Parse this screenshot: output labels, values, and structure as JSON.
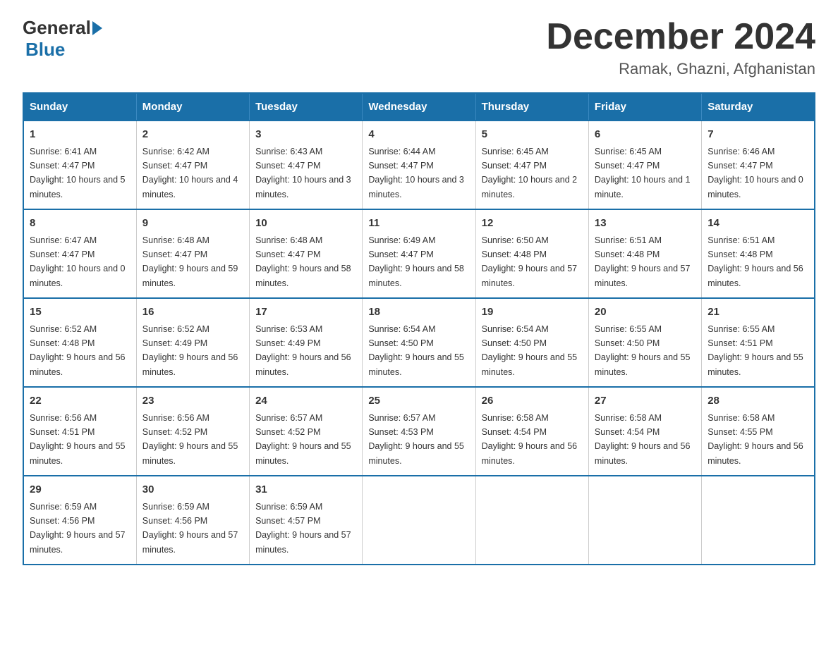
{
  "header": {
    "logo_general": "General",
    "logo_blue": "Blue",
    "month_title": "December 2024",
    "location": "Ramak, Ghazni, Afghanistan"
  },
  "weekdays": [
    "Sunday",
    "Monday",
    "Tuesday",
    "Wednesday",
    "Thursday",
    "Friday",
    "Saturday"
  ],
  "weeks": [
    [
      {
        "day": "1",
        "sunrise": "6:41 AM",
        "sunset": "4:47 PM",
        "daylight": "10 hours and 5 minutes."
      },
      {
        "day": "2",
        "sunrise": "6:42 AM",
        "sunset": "4:47 PM",
        "daylight": "10 hours and 4 minutes."
      },
      {
        "day": "3",
        "sunrise": "6:43 AM",
        "sunset": "4:47 PM",
        "daylight": "10 hours and 3 minutes."
      },
      {
        "day": "4",
        "sunrise": "6:44 AM",
        "sunset": "4:47 PM",
        "daylight": "10 hours and 3 minutes."
      },
      {
        "day": "5",
        "sunrise": "6:45 AM",
        "sunset": "4:47 PM",
        "daylight": "10 hours and 2 minutes."
      },
      {
        "day": "6",
        "sunrise": "6:45 AM",
        "sunset": "4:47 PM",
        "daylight": "10 hours and 1 minute."
      },
      {
        "day": "7",
        "sunrise": "6:46 AM",
        "sunset": "4:47 PM",
        "daylight": "10 hours and 0 minutes."
      }
    ],
    [
      {
        "day": "8",
        "sunrise": "6:47 AM",
        "sunset": "4:47 PM",
        "daylight": "10 hours and 0 minutes."
      },
      {
        "day": "9",
        "sunrise": "6:48 AM",
        "sunset": "4:47 PM",
        "daylight": "9 hours and 59 minutes."
      },
      {
        "day": "10",
        "sunrise": "6:48 AM",
        "sunset": "4:47 PM",
        "daylight": "9 hours and 58 minutes."
      },
      {
        "day": "11",
        "sunrise": "6:49 AM",
        "sunset": "4:47 PM",
        "daylight": "9 hours and 58 minutes."
      },
      {
        "day": "12",
        "sunrise": "6:50 AM",
        "sunset": "4:48 PM",
        "daylight": "9 hours and 57 minutes."
      },
      {
        "day": "13",
        "sunrise": "6:51 AM",
        "sunset": "4:48 PM",
        "daylight": "9 hours and 57 minutes."
      },
      {
        "day": "14",
        "sunrise": "6:51 AM",
        "sunset": "4:48 PM",
        "daylight": "9 hours and 56 minutes."
      }
    ],
    [
      {
        "day": "15",
        "sunrise": "6:52 AM",
        "sunset": "4:48 PM",
        "daylight": "9 hours and 56 minutes."
      },
      {
        "day": "16",
        "sunrise": "6:52 AM",
        "sunset": "4:49 PM",
        "daylight": "9 hours and 56 minutes."
      },
      {
        "day": "17",
        "sunrise": "6:53 AM",
        "sunset": "4:49 PM",
        "daylight": "9 hours and 56 minutes."
      },
      {
        "day": "18",
        "sunrise": "6:54 AM",
        "sunset": "4:50 PM",
        "daylight": "9 hours and 55 minutes."
      },
      {
        "day": "19",
        "sunrise": "6:54 AM",
        "sunset": "4:50 PM",
        "daylight": "9 hours and 55 minutes."
      },
      {
        "day": "20",
        "sunrise": "6:55 AM",
        "sunset": "4:50 PM",
        "daylight": "9 hours and 55 minutes."
      },
      {
        "day": "21",
        "sunrise": "6:55 AM",
        "sunset": "4:51 PM",
        "daylight": "9 hours and 55 minutes."
      }
    ],
    [
      {
        "day": "22",
        "sunrise": "6:56 AM",
        "sunset": "4:51 PM",
        "daylight": "9 hours and 55 minutes."
      },
      {
        "day": "23",
        "sunrise": "6:56 AM",
        "sunset": "4:52 PM",
        "daylight": "9 hours and 55 minutes."
      },
      {
        "day": "24",
        "sunrise": "6:57 AM",
        "sunset": "4:52 PM",
        "daylight": "9 hours and 55 minutes."
      },
      {
        "day": "25",
        "sunrise": "6:57 AM",
        "sunset": "4:53 PM",
        "daylight": "9 hours and 55 minutes."
      },
      {
        "day": "26",
        "sunrise": "6:58 AM",
        "sunset": "4:54 PM",
        "daylight": "9 hours and 56 minutes."
      },
      {
        "day": "27",
        "sunrise": "6:58 AM",
        "sunset": "4:54 PM",
        "daylight": "9 hours and 56 minutes."
      },
      {
        "day": "28",
        "sunrise": "6:58 AM",
        "sunset": "4:55 PM",
        "daylight": "9 hours and 56 minutes."
      }
    ],
    [
      {
        "day": "29",
        "sunrise": "6:59 AM",
        "sunset": "4:56 PM",
        "daylight": "9 hours and 57 minutes."
      },
      {
        "day": "30",
        "sunrise": "6:59 AM",
        "sunset": "4:56 PM",
        "daylight": "9 hours and 57 minutes."
      },
      {
        "day": "31",
        "sunrise": "6:59 AM",
        "sunset": "4:57 PM",
        "daylight": "9 hours and 57 minutes."
      },
      null,
      null,
      null,
      null
    ]
  ]
}
